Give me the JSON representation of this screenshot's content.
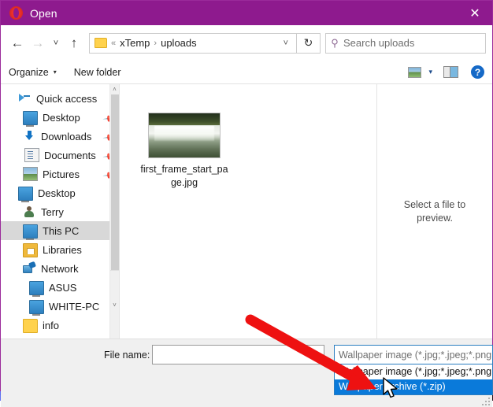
{
  "window": {
    "title": "Open",
    "app_icon": "opera-logo-icon",
    "close_label": "✕",
    "titlebar_color": "#8e1a8e"
  },
  "nav": {
    "back": "←",
    "forward": "→",
    "recent": "˅",
    "up": "↑",
    "refresh": "↻",
    "address": {
      "folder_icon": "folder-icon",
      "overflow": "«",
      "crumbs": [
        "xTemp",
        "uploads"
      ],
      "separator": "›",
      "dropdown": "˅"
    },
    "search": {
      "icon": "search-icon",
      "placeholder": "Search uploads",
      "value": ""
    }
  },
  "toolbar": {
    "organize_label": "Organize",
    "organize_caret": "▾",
    "new_folder_label": "New folder",
    "view_icon": "picture-view-icon",
    "view_caret": "▾",
    "preview_pane_icon": "preview-pane-icon",
    "help_label": "?"
  },
  "sidebar": {
    "items": [
      {
        "label": "Quick access",
        "icon": "star-pin-icon",
        "indent": 0,
        "pinned": false,
        "selected": false
      },
      {
        "label": "Desktop",
        "icon": "monitor-icon",
        "indent": 1,
        "pinned": true,
        "selected": false
      },
      {
        "label": "Downloads",
        "icon": "download-arrow-icon",
        "indent": 1,
        "pinned": true,
        "selected": false
      },
      {
        "label": "Documents",
        "icon": "document-icon",
        "indent": 1,
        "pinned": true,
        "selected": false
      },
      {
        "label": "Pictures",
        "icon": "picture-icon",
        "indent": 1,
        "pinned": true,
        "selected": false
      },
      {
        "label": "Desktop",
        "icon": "monitor-icon",
        "indent": 0,
        "pinned": false,
        "selected": false
      },
      {
        "label": "Terry",
        "icon": "user-icon",
        "indent": 1,
        "pinned": false,
        "selected": false
      },
      {
        "label": "This PC",
        "icon": "monitor-icon",
        "indent": 1,
        "pinned": false,
        "selected": true
      },
      {
        "label": "Libraries",
        "icon": "library-folder-icon",
        "indent": 1,
        "pinned": false,
        "selected": false
      },
      {
        "label": "Network",
        "icon": "network-icon",
        "indent": 1,
        "pinned": false,
        "selected": false
      },
      {
        "label": "ASUS",
        "icon": "monitor-icon",
        "indent": 2,
        "pinned": false,
        "selected": false
      },
      {
        "label": "WHITE-PC",
        "icon": "monitor-icon",
        "indent": 2,
        "pinned": false,
        "selected": false
      },
      {
        "label": "info",
        "icon": "folder-icon",
        "indent": 1,
        "pinned": false,
        "selected": false
      }
    ],
    "scroll_up": "˄",
    "scroll_down": "˅"
  },
  "files": [
    {
      "name": "first_frame_start_page.jpg",
      "thumbnail": "waterfall-photo-thumbnail"
    }
  ],
  "preview": {
    "empty_message": "Select a file to preview."
  },
  "bottom": {
    "filename_label": "File name:",
    "filename_value": "",
    "filename_caret": "˅",
    "filter_selected": "Wallpaper image (*.jpg;*.jpeg;*.png;*.s",
    "filter_options": [
      {
        "label": "Wallpaper image (*.jpg;*.jpeg;*.png;*.s",
        "highlighted": false
      },
      {
        "label": "Wallpaper archive (*.zip)",
        "highlighted": true
      }
    ]
  },
  "annotation": {
    "arrow_color": "#ee1111",
    "description": "red-arrow-pointing-to-wallpaper-archive-option"
  }
}
